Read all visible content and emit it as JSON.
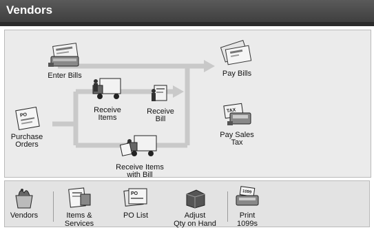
{
  "window": {
    "title": "Vendors"
  },
  "flow": {
    "enter_bills": "Enter Bills",
    "pay_bills": "Pay Bills",
    "receive_items_1": "Receive",
    "receive_items_2": "Items",
    "receive_bill_1": "Receive",
    "receive_bill_2": "Bill",
    "purchase_orders_1": "Purchase",
    "purchase_orders_2": "Orders",
    "pay_sales_tax_1": "Pay Sales",
    "pay_sales_tax_2": "Tax",
    "receive_items_with_bill_1": "Receive Items",
    "receive_items_with_bill_2": "with Bill",
    "po_tag": "PO",
    "tax_tag": "TAX"
  },
  "toolbar": {
    "vendors": "Vendors",
    "items_services_1": "Items &",
    "items_services_2": "Services",
    "po_list": "PO List",
    "adjust_qty_1": "Adjust",
    "adjust_qty_2": "Qty on Hand",
    "print_1099_1": "Print",
    "print_1099_2": "1099s",
    "po_tag": "PO",
    "tag_1099": "1099"
  },
  "colors": {
    "titlebar": "#4a4a4a",
    "panel": "#ebebeb",
    "flow_arrow": "#c9c9c9",
    "toolbar": "#e3e3e3"
  }
}
